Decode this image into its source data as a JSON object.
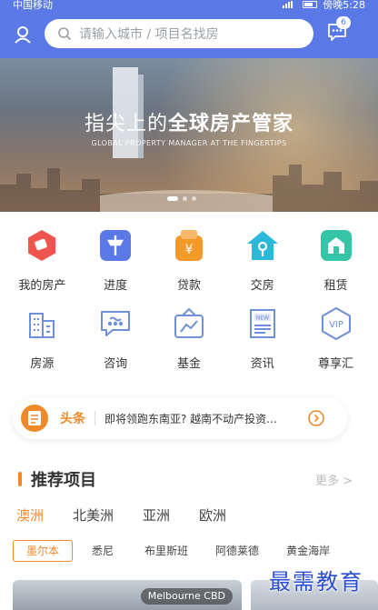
{
  "status": {
    "carrier": "中国移动",
    "time": "傍晚5:28"
  },
  "search": {
    "placeholder": "请输入城市 / 项目名找房"
  },
  "messages": {
    "badge": "6"
  },
  "banner": {
    "title_pre": "指尖上的",
    "title_bold": "全球房产管家",
    "subtitle": "GLOBAL PROPERTY MANAGER AT THE FINGERTIPS",
    "active_slide": 1,
    "slide_count": 3
  },
  "grid": [
    [
      {
        "label": "我的房产",
        "icon": "my-property-icon",
        "color": "#f0544f"
      },
      {
        "label": "进度",
        "icon": "progress-icon",
        "color": "#5a79e6"
      },
      {
        "label": "贷款",
        "icon": "loan-icon",
        "color": "#f39a2b"
      },
      {
        "label": "交房",
        "icon": "handover-icon",
        "color": "#2cb8d8"
      },
      {
        "label": "租赁",
        "icon": "lease-icon",
        "color": "#35c4a5"
      }
    ],
    [
      {
        "label": "房源",
        "icon": "listings-icon",
        "color": "#6f8fd8"
      },
      {
        "label": "咨询",
        "icon": "consult-icon",
        "color": "#6f8fd8"
      },
      {
        "label": "基金",
        "icon": "fund-icon",
        "color": "#6f8fd8"
      },
      {
        "label": "资讯",
        "icon": "news-icon",
        "color": "#6f8fd8"
      },
      {
        "label": "尊享汇",
        "icon": "vip-icon",
        "color": "#6f8fd8"
      }
    ]
  ],
  "headline": {
    "tag": "头条",
    "text": "即将领跑东南亚? 越南不动产投资..."
  },
  "recommend": {
    "title": "推荐项目",
    "more": "更多 >",
    "tabs": [
      "澳洲",
      "北美洲",
      "亚洲",
      "欧洲"
    ],
    "active_tab": 0,
    "cities": [
      "墨尔本",
      "悉尼",
      "布里斯班",
      "阿德莱德",
      "黄金海岸"
    ],
    "active_city": 0,
    "cards": [
      {
        "label": "Melbourne CBD"
      }
    ]
  },
  "watermark": "最需教育",
  "colors": {
    "primary": "#5a79e6",
    "accent": "#f08a2b"
  }
}
